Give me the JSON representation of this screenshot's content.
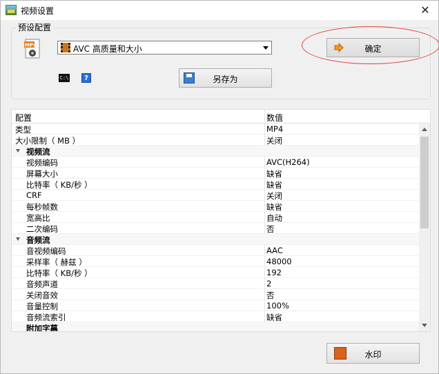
{
  "window": {
    "title": "视频设置",
    "close_glyph": "✕"
  },
  "preset": {
    "group_label": "预设配置",
    "selected": "AVC 高质量和大小",
    "ok_label": "确定",
    "save_as_label": "另存为",
    "cmd_icon_text": "C:\\",
    "help_icon_text": "?",
    "mp4_icon_text": "MP4"
  },
  "grid": {
    "col_key": "配置",
    "col_value": "数值",
    "rows": [
      {
        "k": "类型",
        "v": "MP4"
      },
      {
        "k": "大小限制（ MB ）",
        "v": "关闭"
      },
      {
        "k": "视频流",
        "v": "",
        "cat": true
      },
      {
        "k": "视频编码",
        "v": "AVC(H264)"
      },
      {
        "k": "屏幕大小",
        "v": "缺省"
      },
      {
        "k": "比特率（ KB/秒 ）",
        "v": "缺省"
      },
      {
        "k": "CRF",
        "v": "关闭"
      },
      {
        "k": "每秒帧数",
        "v": "缺省"
      },
      {
        "k": "宽高比",
        "v": "自动"
      },
      {
        "k": "二次编码",
        "v": "否"
      },
      {
        "k": "音频流",
        "v": "",
        "cat": true
      },
      {
        "k": "音视频编码",
        "v": "AAC"
      },
      {
        "k": "采样率（ 赫兹 ）",
        "v": "48000"
      },
      {
        "k": "比特率（ KB/秒 ）",
        "v": "192"
      },
      {
        "k": "音频声道",
        "v": "2"
      },
      {
        "k": "关闭音效",
        "v": "否"
      },
      {
        "k": "音量控制",
        "v": "100%"
      },
      {
        "k": "音频流索引",
        "v": "缺省"
      },
      {
        "k": "附加字幕",
        "v": "",
        "catlast": true
      }
    ]
  },
  "footer": {
    "watermark_label": "水印"
  },
  "colors": {
    "highlight_ellipse": "#e0403a",
    "window_bg": "#f0f0f0"
  }
}
